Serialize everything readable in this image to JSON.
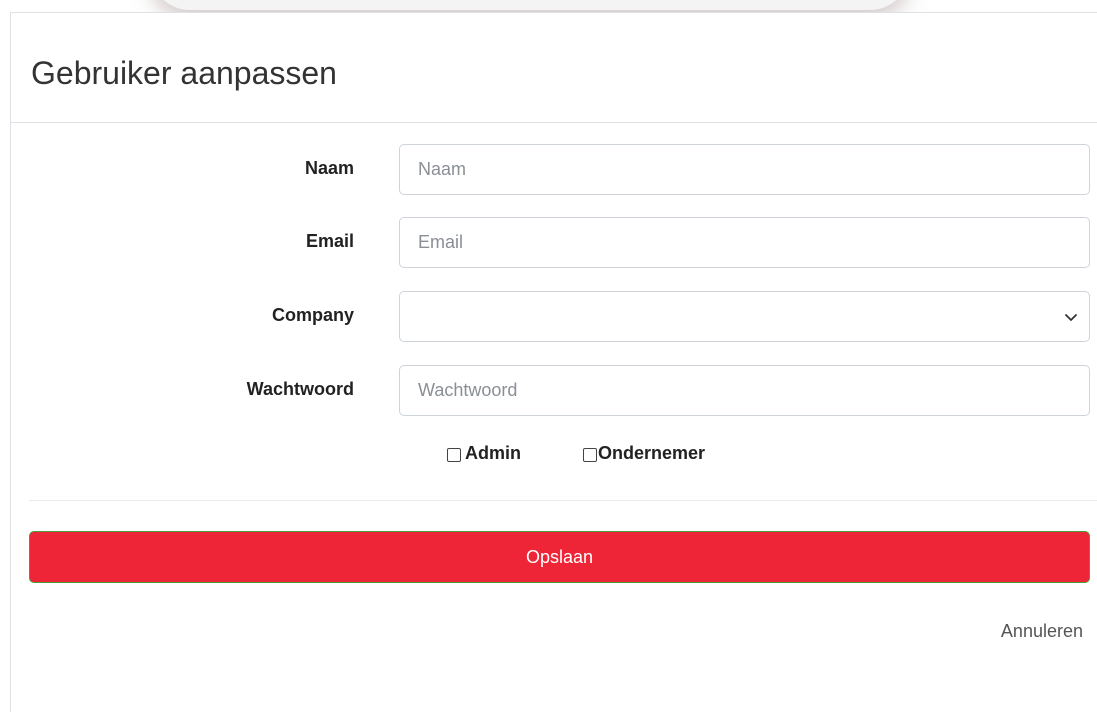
{
  "modal": {
    "title": "Gebruiker aanpassen"
  },
  "form": {
    "name": {
      "label": "Naam",
      "placeholder": "Naam",
      "value": ""
    },
    "email": {
      "label": "Email",
      "placeholder": "Email",
      "value": ""
    },
    "company": {
      "label": "Company",
      "selected": ""
    },
    "password": {
      "label": "Wachtwoord",
      "placeholder": "Wachtwoord",
      "value": ""
    },
    "checkboxes": {
      "admin": {
        "label": "Admin",
        "checked": false
      },
      "entrepreneur": {
        "label": "Ondernemer",
        "checked": false
      }
    }
  },
  "actions": {
    "save_label": "Opslaan",
    "cancel_label": "Annuleren"
  },
  "colors": {
    "save_button": "#ee2536",
    "border": "#ced4da"
  },
  "icons": {
    "select_chevron": "chevron-down-icon"
  }
}
